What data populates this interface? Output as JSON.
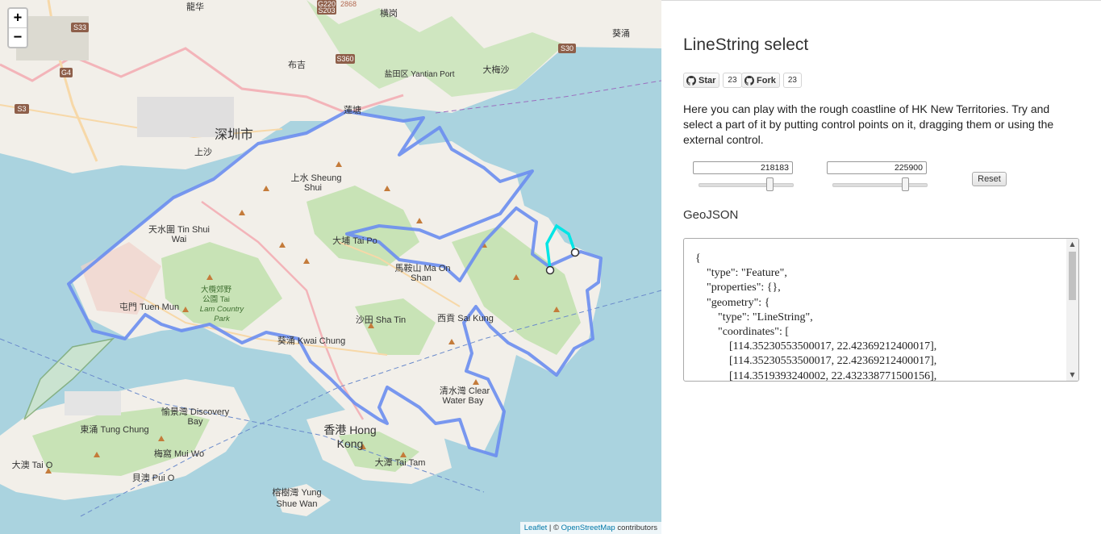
{
  "map": {
    "zoom_in": "+",
    "zoom_out": "−",
    "labels": [
      {
        "text": "龍华"
      },
      {
        "text": "深圳市"
      },
      {
        "text": "上水 Sheung Shui"
      },
      {
        "text": "天水圍 Tin Shui Wai"
      },
      {
        "text": "屯門 Tuen Mun"
      },
      {
        "text": "大欖郊野公園 Tai Lam Country Park"
      },
      {
        "text": "大埔 Tai Po"
      },
      {
        "text": "馬鞍山 Ma On Shan"
      },
      {
        "text": "沙田 Sha Tin"
      },
      {
        "text": "西貢 Sai Kung"
      },
      {
        "text": "葵涌 Kwai Chung"
      },
      {
        "text": "清水灣 Clear Water Bay"
      },
      {
        "text": "香港 Hong Kong"
      },
      {
        "text": "愉景灣 Discovery Bay"
      },
      {
        "text": "東涌 Tung Chung"
      },
      {
        "text": "梅窩 Mui Wo"
      },
      {
        "text": "大澳 Tai O"
      },
      {
        "text": "貝澳 Pui O"
      },
      {
        "text": "大潭 Tai Tam"
      },
      {
        "text": "榕樹灣 Yung Shue Wan"
      },
      {
        "text": "布吉"
      },
      {
        "text": "盐田区 Yantian Port"
      },
      {
        "text": "大梅沙"
      },
      {
        "text": "葵涌"
      },
      {
        "text": "横岗"
      },
      {
        "text": "上沙"
      },
      {
        "text": "蓮塘"
      }
    ],
    "road_shields": [
      "G220",
      "S203",
      "S33",
      "G4",
      "S3",
      "S360",
      "S30",
      "2868"
    ],
    "attribution": {
      "leaflet": "Leaflet",
      "sep": " | © ",
      "osm": "OpenStreetMap",
      "suffix": " contributors"
    }
  },
  "panel": {
    "title": "LineString select",
    "github": {
      "star_label": "Star",
      "star_count": "23",
      "fork_label": "Fork",
      "fork_count": "23"
    },
    "description": "Here you can play with the rough coastline of HK New Territories. Try and select a part of it by putting control points on it, dragging them or using the external control.",
    "start_value": "218183",
    "end_value": "225900",
    "start_fraction": 0.75,
    "end_fraction": 0.77,
    "reset_label": "Reset",
    "geojson_heading": "GeoJSON",
    "geojson_text": "{\n\t\"type\": \"Feature\",\n\t\"properties\": {},\n\t\"geometry\": {\n\t\t\"type\": \"LineString\",\n\t\t\"coordinates\": [\n\t\t\t[114.35230553500017, 22.42369212400017],\n\t\t\t[114.35230553500017, 22.42369212400017],\n\t\t\t[114.3519393240002, 22.432338771500156],"
  },
  "colors": {
    "water": "#aad3df",
    "land": "#f2efe9",
    "park": "#c8e3b6",
    "selection_line": "#6a8df0",
    "selected_segment": "#00e5e5"
  }
}
